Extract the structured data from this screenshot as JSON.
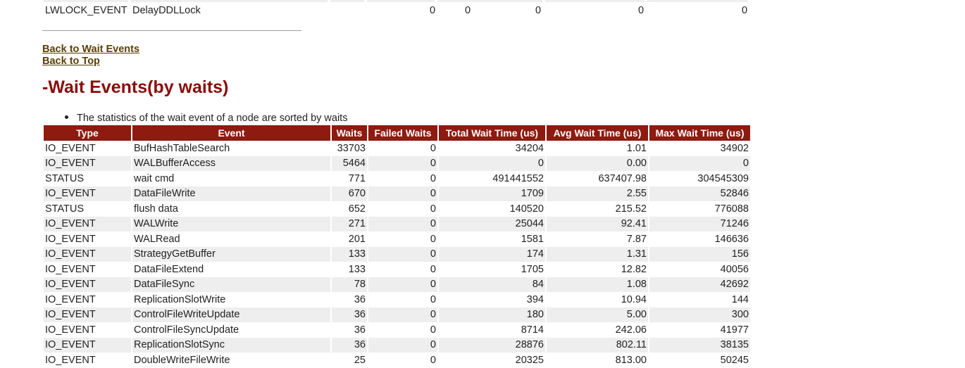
{
  "top_row": {
    "type": "LWLOCK_EVENT",
    "event": "DelayDDLLock",
    "values": [
      "0",
      "0",
      "0",
      "0",
      "0"
    ]
  },
  "links": {
    "back_to_wait_events": "Back to Wait Events",
    "back_to_top": "Back to Top"
  },
  "section": {
    "title": "-Wait Events(by waits)",
    "note": "The statistics of the wait event of a node are sorted by waits"
  },
  "table": {
    "headers": [
      "Type",
      "Event",
      "Waits",
      "Failed Waits",
      "Total Wait Time (us)",
      "Avg Wait Time (us)",
      "Max Wait Time (us)"
    ],
    "rows": [
      [
        "IO_EVENT",
        "BufHashTableSearch",
        "33703",
        "0",
        "34204",
        "1.01",
        "34902"
      ],
      [
        "IO_EVENT",
        "WALBufferAccess",
        "5464",
        "0",
        "0",
        "0.00",
        "0"
      ],
      [
        "STATUS",
        "wait cmd",
        "771",
        "0",
        "491441552",
        "637407.98",
        "304545309"
      ],
      [
        "IO_EVENT",
        "DataFileWrite",
        "670",
        "0",
        "1709",
        "2.55",
        "52846"
      ],
      [
        "STATUS",
        "flush data",
        "652",
        "0",
        "140520",
        "215.52",
        "776088"
      ],
      [
        "IO_EVENT",
        "WALWrite",
        "271",
        "0",
        "25044",
        "92.41",
        "71246"
      ],
      [
        "IO_EVENT",
        "WALRead",
        "201",
        "0",
        "1581",
        "7.87",
        "146636"
      ],
      [
        "IO_EVENT",
        "StrategyGetBuffer",
        "133",
        "0",
        "174",
        "1.31",
        "156"
      ],
      [
        "IO_EVENT",
        "DataFileExtend",
        "133",
        "0",
        "1705",
        "12.82",
        "40056"
      ],
      [
        "IO_EVENT",
        "DataFileSync",
        "78",
        "0",
        "84",
        "1.08",
        "42692"
      ],
      [
        "IO_EVENT",
        "ReplicationSlotWrite",
        "36",
        "0",
        "394",
        "10.94",
        "144"
      ],
      [
        "IO_EVENT",
        "ControlFileWriteUpdate",
        "36",
        "0",
        "180",
        "5.00",
        "300"
      ],
      [
        "IO_EVENT",
        "ControlFileSyncUpdate",
        "36",
        "0",
        "8714",
        "242.06",
        "41977"
      ],
      [
        "IO_EVENT",
        "ReplicationSlotSync",
        "36",
        "0",
        "28876",
        "802.11",
        "38135"
      ],
      [
        "IO_EVENT",
        "DoubleWriteFileWrite",
        "25",
        "0",
        "20325",
        "813.00",
        "50245"
      ]
    ]
  }
}
